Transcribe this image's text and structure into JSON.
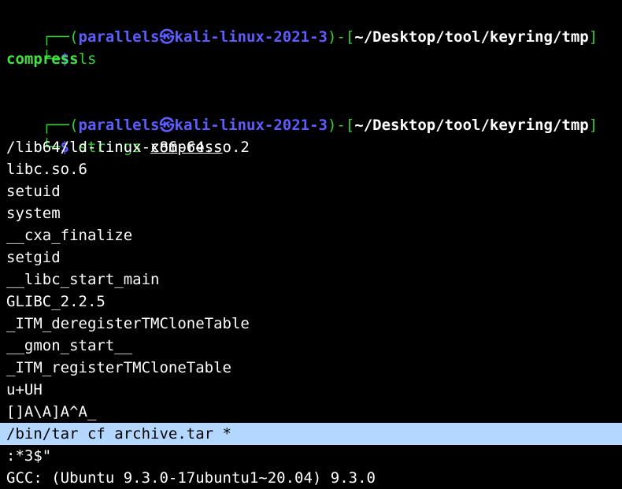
{
  "session": {
    "user": "parallels",
    "at_symbol": "㉿",
    "host": "kali-linux-2021-3",
    "cwd": "~/Desktop/tool/keyring/tmp",
    "colors": {
      "background": "#000000",
      "prompt_frame": "#2fd52f",
      "user_host": "#5c5cff",
      "output": "#ffffff",
      "ls_entry": "#3fe33f",
      "selection": "#b3d7ff"
    }
  },
  "blocks": [
    {
      "prompt": {
        "bracket_open_top": "┌──(",
        "bracket_close_top": ")-[",
        "bracket_end_top": "]",
        "prompt_prefix": "└─",
        "dollar": "$",
        "command": "ls",
        "args": ""
      },
      "output": [
        "compress"
      ]
    },
    {
      "prompt": {
        "bracket_open_top": "┌──(",
        "bracket_close_top": ")-[",
        "bracket_end_top": "]",
        "prompt_prefix": "└─",
        "dollar": "$",
        "command": "strings",
        "args": "compress"
      },
      "output": [
        "/lib64/ld-linux-x86-64.so.2",
        "libc.so.6",
        "setuid",
        "system",
        "__cxa_finalize",
        "setgid",
        "__libc_start_main",
        "GLIBC_2.2.5",
        "_ITM_deregisterTMCloneTable",
        "__gmon_start__",
        "_ITM_registerTMCloneTable",
        "u+UH",
        "[]A\\A]A^A_",
        "/bin/tar cf archive.tar *",
        ":*3$\"",
        "GCC: (Ubuntu 9.3.0-17ubuntu1~20.04) 9.3.0"
      ],
      "highlighted_line": "/bin/tar cf archive.tar *"
    }
  ]
}
